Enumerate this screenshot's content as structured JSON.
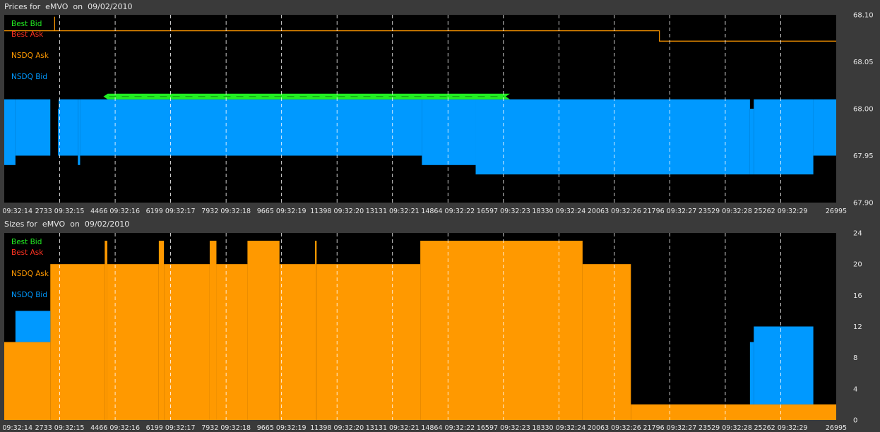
{
  "colors": {
    "background": "#000000",
    "panel": "#3a3a3a",
    "best_bid": "#22ee22",
    "best_ask": "#ff3322",
    "nsdq_ask": "#ff9900",
    "nsdq_bid": "#0099ff",
    "grid": "#ffffff"
  },
  "legend": [
    {
      "key": "best_bid",
      "label": "Best Bid",
      "color": "#22ee22"
    },
    {
      "key": "best_ask",
      "label": "Best Ask",
      "color": "#ff3322"
    },
    {
      "key": "nsdq_ask",
      "label": "NSDQ Ask",
      "color": "#ff9900"
    },
    {
      "key": "nsdq_bid",
      "label": "NSDQ Bid",
      "color": "#0099ff"
    }
  ],
  "chart_data": [
    {
      "type": "area",
      "title": "Prices for  eMVO  on  09/02/2010",
      "xlim": [
        1000,
        26995
      ],
      "ylim": [
        67.9,
        68.1
      ],
      "yticks": [
        "68.10",
        "68.05",
        "68.00",
        "67.95",
        "67.90"
      ],
      "ytick_values": [
        68.1,
        68.05,
        68.0,
        67.95,
        67.9
      ],
      "xticks": [
        {
          "x": 1000,
          "label": "1000 09:32:14"
        },
        {
          "x": 2733,
          "label": "2733 09:32:15"
        },
        {
          "x": 4466,
          "label": "4466 09:32:16"
        },
        {
          "x": 6199,
          "label": "6199 09:32:17"
        },
        {
          "x": 7932,
          "label": "7932 09:32:18"
        },
        {
          "x": 9665,
          "label": "9665 09:32:19"
        },
        {
          "x": 11398,
          "label": "11398 09:32:20"
        },
        {
          "x": 13131,
          "label": "13131 09:32:21"
        },
        {
          "x": 14864,
          "label": "14864 09:32:22"
        },
        {
          "x": 16597,
          "label": "16597 09:32:23"
        },
        {
          "x": 18330,
          "label": "18330 09:32:24"
        },
        {
          "x": 20063,
          "label": "20063 09:32:26"
        },
        {
          "x": 21796,
          "label": "21796 09:32:27"
        },
        {
          "x": 23529,
          "label": "23529 09:32:28"
        },
        {
          "x": 25262,
          "label": "25262 09:32:29"
        },
        {
          "x": 26995,
          "label": "26995"
        }
      ],
      "gridlines_x": [
        2733,
        4466,
        6199,
        7932,
        9665,
        11398,
        13131,
        14864,
        16597,
        18330,
        20063,
        21796,
        23529,
        25262
      ],
      "series": [
        {
          "name": "NSDQ Bid",
          "style": "band",
          "color": "#0099ff",
          "top": 68.01,
          "segments": [
            {
              "x0": 1000,
              "x1": 1350,
              "bottom": 67.94
            },
            {
              "x0": 1350,
              "x1": 2440,
              "bottom": 67.95
            },
            {
              "x0": 2440,
              "x1": 2680,
              "bottom": 67.95,
              "top": 67.95
            },
            {
              "x0": 2680,
              "x1": 2700,
              "bottom": 67.95,
              "top": 68.0
            },
            {
              "x0": 2700,
              "x1": 3300,
              "bottom": 67.95
            },
            {
              "x0": 3300,
              "x1": 3370,
              "bottom": 67.94
            },
            {
              "x0": 3370,
              "x1": 14050,
              "bottom": 67.95
            },
            {
              "x0": 14050,
              "x1": 15730,
              "bottom": 67.94
            },
            {
              "x0": 15730,
              "x1": 24300,
              "bottom": 67.93
            },
            {
              "x0": 24300,
              "x1": 24420,
              "bottom": 67.93,
              "top": 68.0
            },
            {
              "x0": 24420,
              "x1": 26280,
              "bottom": 67.93
            },
            {
              "x0": 26280,
              "x1": 26995,
              "bottom": 67.95
            }
          ]
        },
        {
          "name": "Best Bid",
          "style": "line",
          "color": "#22ee22",
          "points": [
            [
              4100,
              68.013
            ],
            [
              16800,
              68.013
            ]
          ]
        },
        {
          "name": "Best Ask",
          "style": "step",
          "color": "#ff9900",
          "points": [
            [
              1000,
              68.083
            ],
            [
              21470,
              68.083
            ],
            [
              21470,
              68.072
            ],
            [
              26995,
              68.072
            ]
          ]
        },
        {
          "name": "NSDQ Ask",
          "style": "step",
          "color": "#ff9900",
          "points": [
            [
              2575,
              68.098
            ],
            [
              2575,
              68.083
            ]
          ]
        }
      ]
    },
    {
      "type": "area",
      "title": "Sizes for  eMVO  on  09/02/2010",
      "xlim": [
        1000,
        26995
      ],
      "ylim": [
        0,
        24
      ],
      "yticks": [
        "24",
        "20",
        "16",
        "12",
        "8",
        "4",
        "0"
      ],
      "ytick_values": [
        24,
        20,
        16,
        12,
        8,
        4,
        0
      ],
      "xticks": [
        {
          "x": 1000,
          "label": "1000 09:32:14"
        },
        {
          "x": 2733,
          "label": "2733 09:32:15"
        },
        {
          "x": 4466,
          "label": "4466 09:32:16"
        },
        {
          "x": 6199,
          "label": "6199 09:32:17"
        },
        {
          "x": 7932,
          "label": "7932 09:32:18"
        },
        {
          "x": 9665,
          "label": "9665 09:32:19"
        },
        {
          "x": 11398,
          "label": "11398 09:32:20"
        },
        {
          "x": 13131,
          "label": "13131 09:32:21"
        },
        {
          "x": 14864,
          "label": "14864 09:32:22"
        },
        {
          "x": 16597,
          "label": "16597 09:32:23"
        },
        {
          "x": 18330,
          "label": "18330 09:32:24"
        },
        {
          "x": 20063,
          "label": "20063 09:32:26"
        },
        {
          "x": 21796,
          "label": "21796 09:32:27"
        },
        {
          "x": 23529,
          "label": "23529 09:32:28"
        },
        {
          "x": 25262,
          "label": "25262 09:32:29"
        },
        {
          "x": 26995,
          "label": "26995"
        }
      ],
      "gridlines_x": [
        2733,
        4466,
        6199,
        7932,
        9665,
        11398,
        13131,
        14864,
        16597,
        18330,
        20063,
        21796,
        23529,
        25262
      ],
      "series": [
        {
          "name": "NSDQ Ask",
          "style": "bars",
          "color": "#ff9900",
          "segments": [
            {
              "x0": 1000,
              "x1": 2440,
              "value": 10
            },
            {
              "x0": 2440,
              "x1": 4140,
              "value": 20
            },
            {
              "x0": 4140,
              "x1": 4220,
              "value": 23
            },
            {
              "x0": 4220,
              "x1": 5830,
              "value": 20
            },
            {
              "x0": 5830,
              "x1": 5990,
              "value": 23
            },
            {
              "x0": 5990,
              "x1": 7420,
              "value": 20
            },
            {
              "x0": 7420,
              "x1": 7630,
              "value": 23
            },
            {
              "x0": 7630,
              "x1": 8600,
              "value": 20
            },
            {
              "x0": 8600,
              "x1": 9600,
              "value": 23
            },
            {
              "x0": 9600,
              "x1": 10710,
              "value": 20
            },
            {
              "x0": 10710,
              "x1": 10760,
              "value": 23
            },
            {
              "x0": 10760,
              "x1": 14000,
              "value": 20
            },
            {
              "x0": 14000,
              "x1": 19070,
              "value": 23
            },
            {
              "x0": 19070,
              "x1": 20580,
              "value": 20
            },
            {
              "x0": 20580,
              "x1": 26995,
              "value": 2
            }
          ]
        },
        {
          "name": "NSDQ Bid",
          "style": "bars",
          "color": "#0099ff",
          "segments": [
            {
              "x0": 1350,
              "x1": 2440,
              "base": 10,
              "value": 14
            },
            {
              "x0": 24300,
              "x1": 24420,
              "base": 2,
              "value": 10
            },
            {
              "x0": 24420,
              "x1": 26280,
              "base": 2,
              "value": 12
            }
          ]
        }
      ]
    }
  ]
}
